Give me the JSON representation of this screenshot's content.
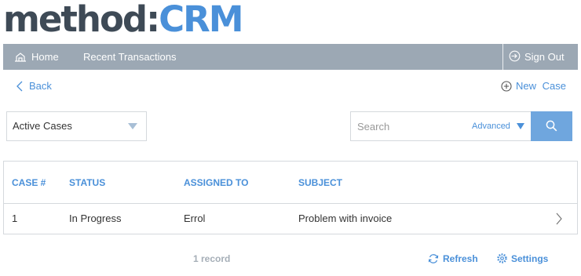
{
  "brand": {
    "logo_part1": "method:",
    "logo_part2": "CRM"
  },
  "nav": {
    "home_label": "Home",
    "home_icon": "home-icon",
    "recent_label": "Recent Transactions",
    "signout_label": "Sign Out",
    "signout_icon": "sign-out-icon"
  },
  "actions": {
    "back_label": "Back",
    "back_icon": "chevron-left-icon",
    "new_case_label": "New Case",
    "new_case_icon": "plus-circle-icon"
  },
  "filter": {
    "view_selected": "Active Cases"
  },
  "search": {
    "placeholder": "Search",
    "advanced_label": "Advanced",
    "button_icon": "search-icon"
  },
  "table": {
    "columns": [
      "CASE #",
      "STATUS",
      "ASSIGNED TO",
      "SUBJECT"
    ],
    "rows": [
      {
        "case_no": "1",
        "status": "In Progress",
        "assigned_to": "Errol",
        "subject": "Problem with invoice"
      }
    ]
  },
  "footer": {
    "record_count": "1 record",
    "refresh_label": "Refresh",
    "settings_label": "Settings"
  },
  "colors": {
    "accent": "#4a90d9",
    "logo_dark": "#3e4a56",
    "navbar": "#9ca8b4",
    "search_button": "#6fa6de",
    "muted_text": "#a5aeb7"
  }
}
